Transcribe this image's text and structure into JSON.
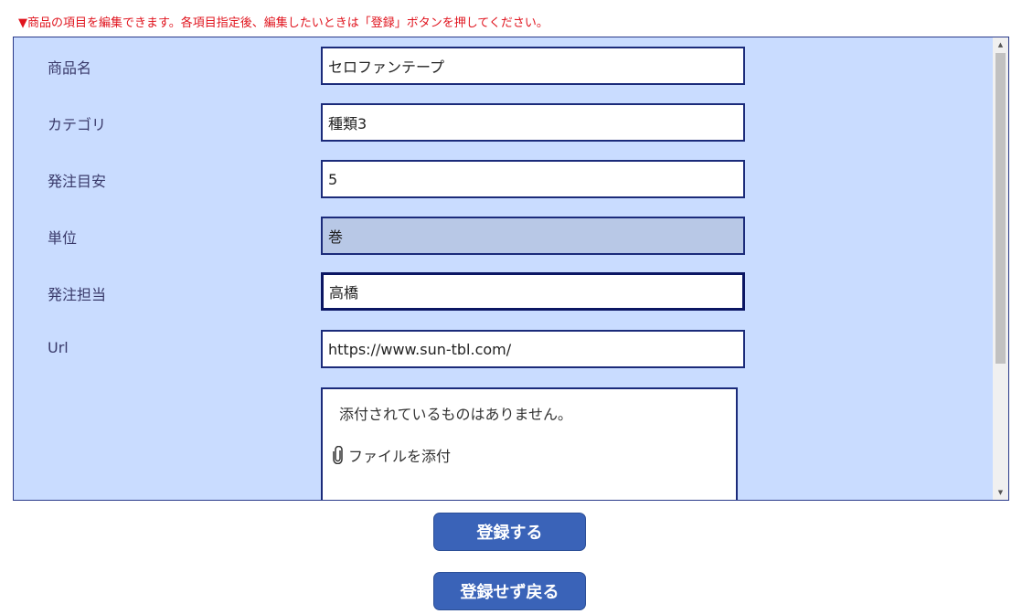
{
  "notice": "▼商品の項目を編集できます。各項目指定後、編集したいときは「登録」ボタンを押してください。",
  "fields": [
    {
      "label": "商品名",
      "value": "セロファンテープ"
    },
    {
      "label": "カテゴリ",
      "value": "種類3"
    },
    {
      "label": "発注目安",
      "value": "5"
    },
    {
      "label": "単位",
      "value": "巻"
    },
    {
      "label": "発注担当",
      "value": "高橋"
    },
    {
      "label": "Url",
      "value": "https://www.sun-tbl.com/"
    }
  ],
  "attachments": {
    "empty_message": "添付されているものはありません。",
    "add_label": "ファイルを添付",
    "icon": "paperclip-icon"
  },
  "buttons": {
    "register": "登録する",
    "back": "登録せず戻る"
  },
  "colors": {
    "notice": "#e0141e",
    "panel": "#c9dcff",
    "field_border": "#1b2b7a",
    "readonly_field": "#b8c8e6",
    "button": "#3a63b8"
  }
}
